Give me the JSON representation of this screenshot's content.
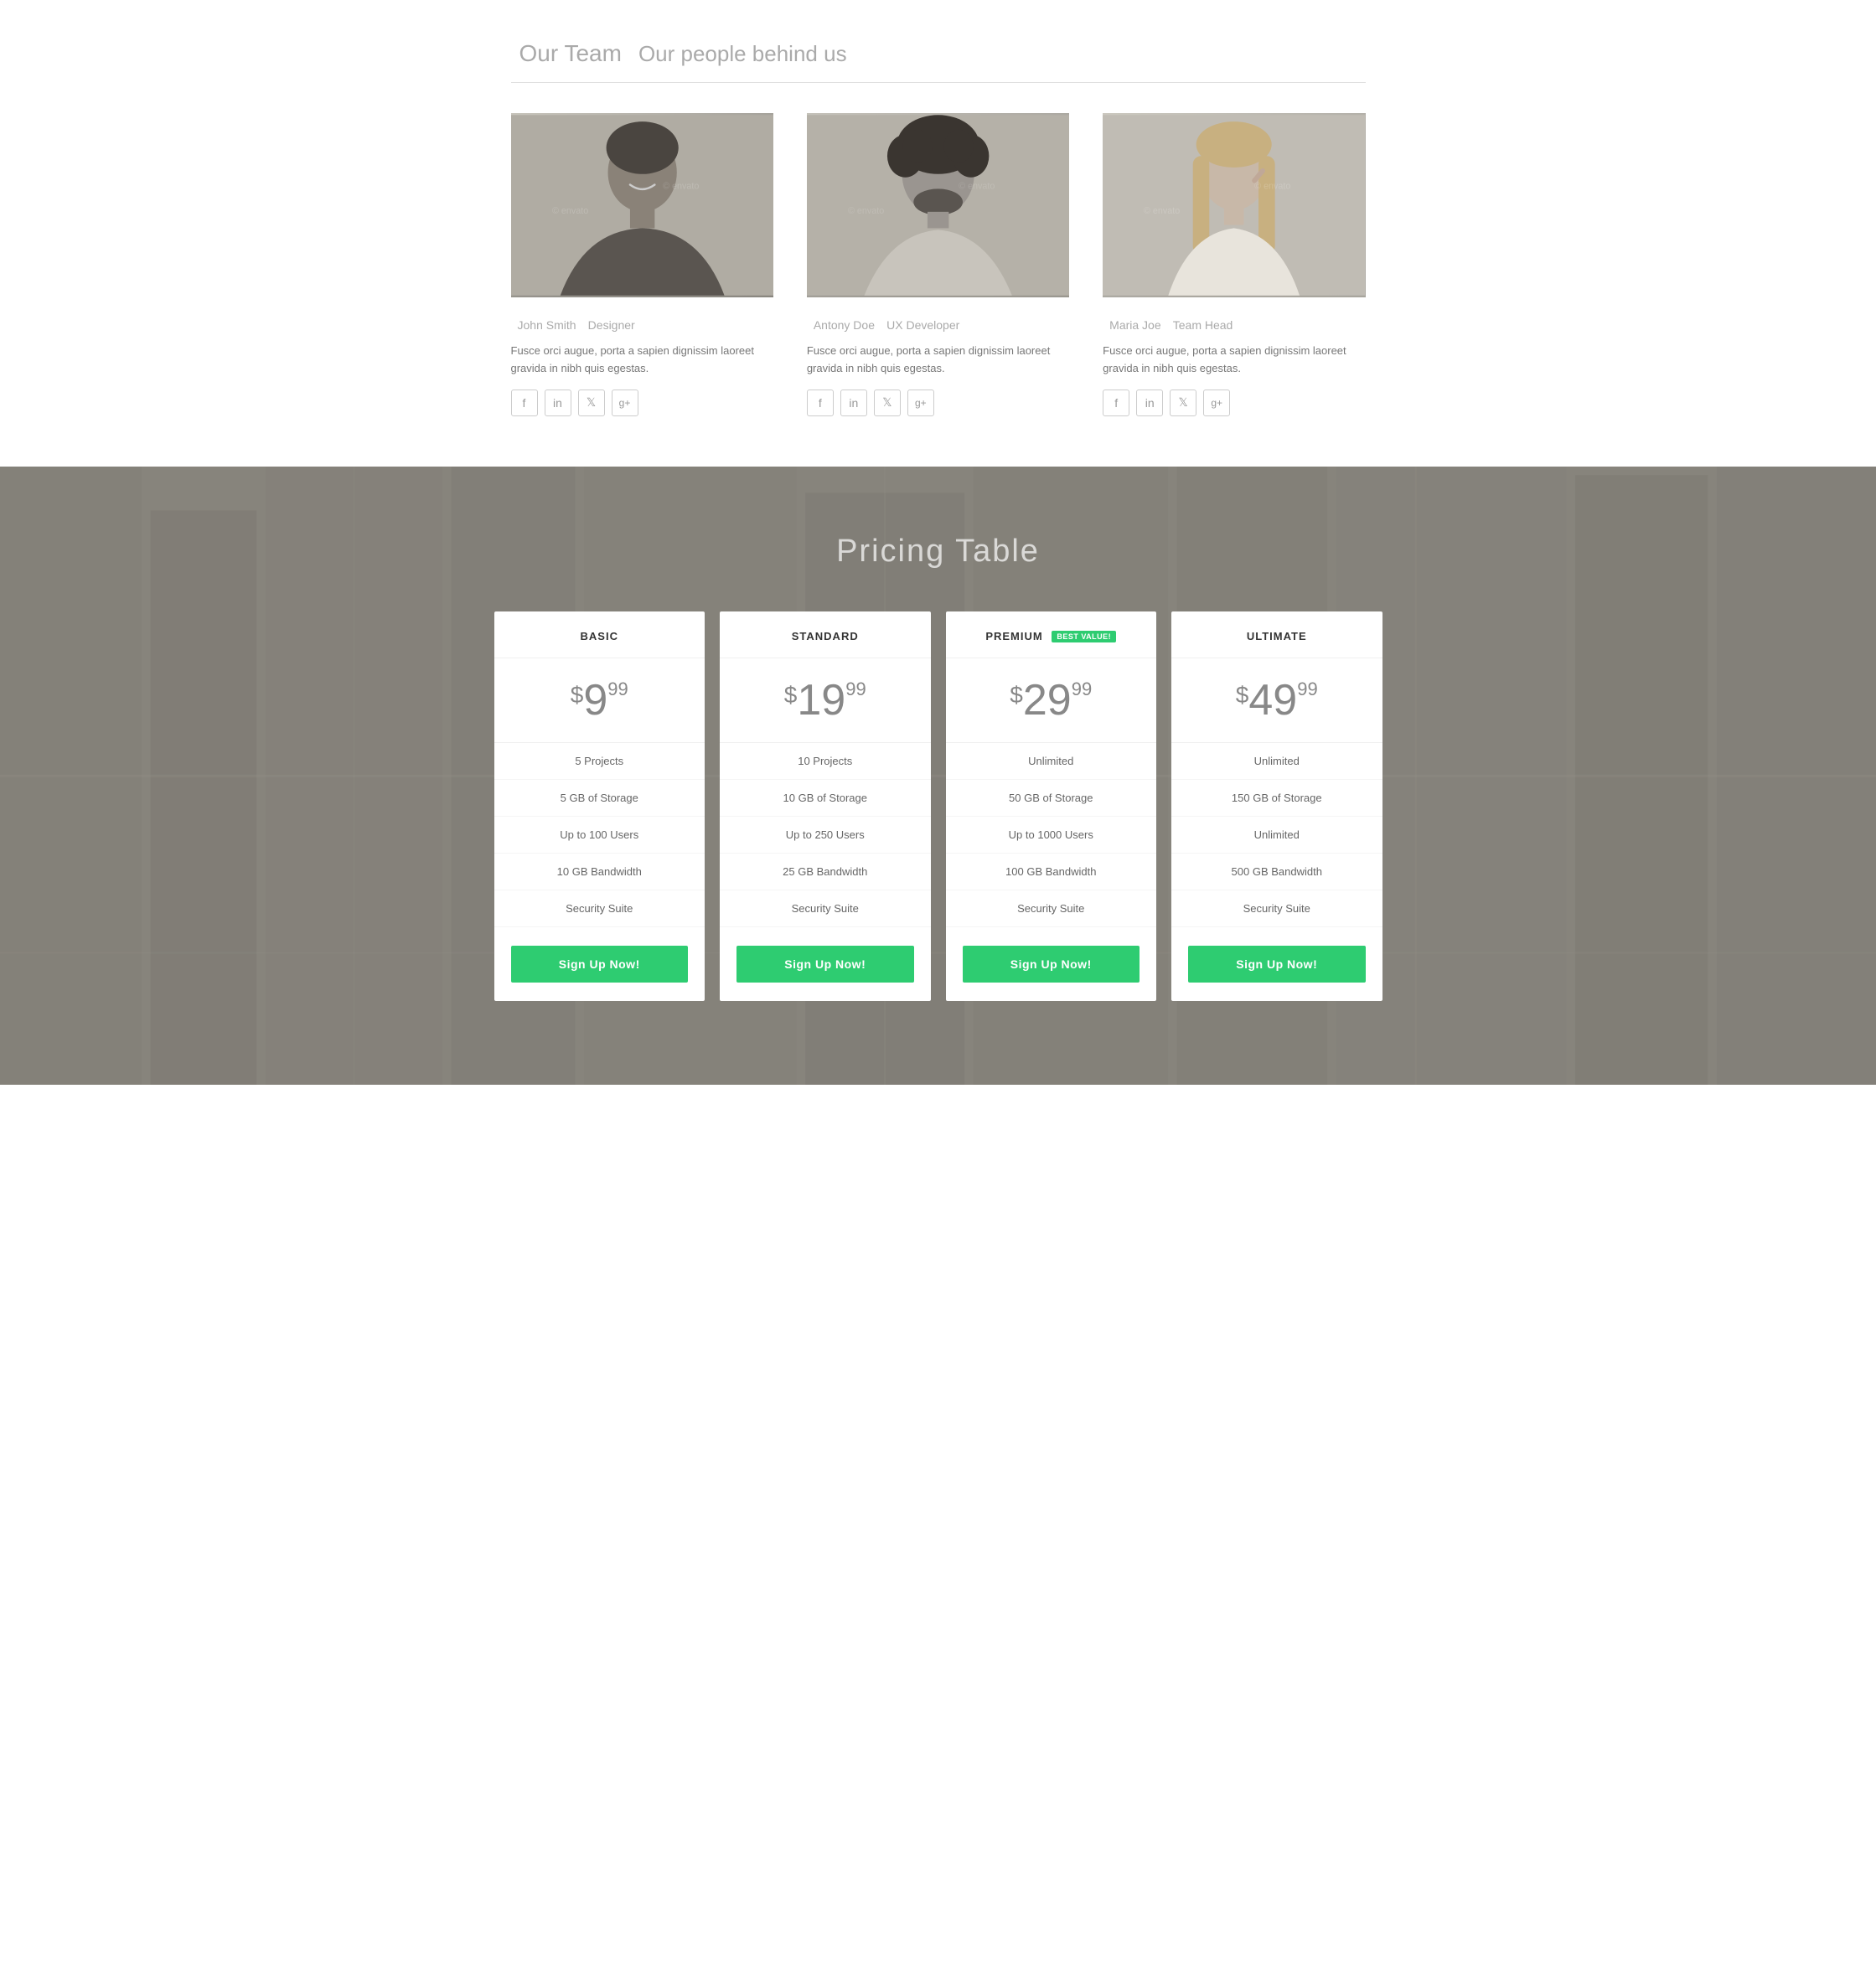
{
  "team": {
    "section_title": "Our Team",
    "section_subtitle": "Our people behind us",
    "members": [
      {
        "name": "John Smith",
        "role": "Designer",
        "bio": "Fusce orci augue, porta a sapien dignissim laoreet gravida in nibh quis egestas.",
        "photo_label": "person-1"
      },
      {
        "name": "Antony Doe",
        "role": "UX Developer",
        "bio": "Fusce orci augue, porta a sapien dignissim laoreet gravida in nibh quis egestas.",
        "photo_label": "person-2"
      },
      {
        "name": "Maria Joe",
        "role": "Team Head",
        "bio": "Fusce orci augue, porta a sapien dignissim laoreet gravida in nibh quis egestas.",
        "photo_label": "person-3"
      }
    ],
    "social_links": [
      "facebook",
      "linkedin",
      "twitter",
      "google-plus"
    ]
  },
  "pricing": {
    "section_title": "Pricing Table",
    "plans": [
      {
        "name": "BASIC",
        "badge": null,
        "price_symbol": "$",
        "price_whole": "9",
        "price_cents": "99",
        "features": [
          "5 Projects",
          "5 GB of Storage",
          "Up to 100 Users",
          "10 GB Bandwidth",
          "Security Suite"
        ],
        "cta": "Sign Up Now!"
      },
      {
        "name": "STANDARD",
        "badge": null,
        "price_symbol": "$",
        "price_whole": "19",
        "price_cents": "99",
        "features": [
          "10 Projects",
          "10 GB of Storage",
          "Up to 250 Users",
          "25 GB Bandwidth",
          "Security Suite"
        ],
        "cta": "Sign Up Now!"
      },
      {
        "name": "PREMIUM",
        "badge": "BEST VALUE!",
        "price_symbol": "$",
        "price_whole": "29",
        "price_cents": "99",
        "features": [
          "Unlimited",
          "50 GB of Storage",
          "Up to 1000 Users",
          "100 GB Bandwidth",
          "Security Suite"
        ],
        "cta": "Sign Up Now!"
      },
      {
        "name": "ULTIMATE",
        "badge": null,
        "price_symbol": "$",
        "price_whole": "49",
        "price_cents": "99",
        "features": [
          "Unlimited",
          "150 GB of Storage",
          "Unlimited",
          "500 GB Bandwidth",
          "Security Suite"
        ],
        "cta": "Sign Up Now!"
      }
    ]
  }
}
